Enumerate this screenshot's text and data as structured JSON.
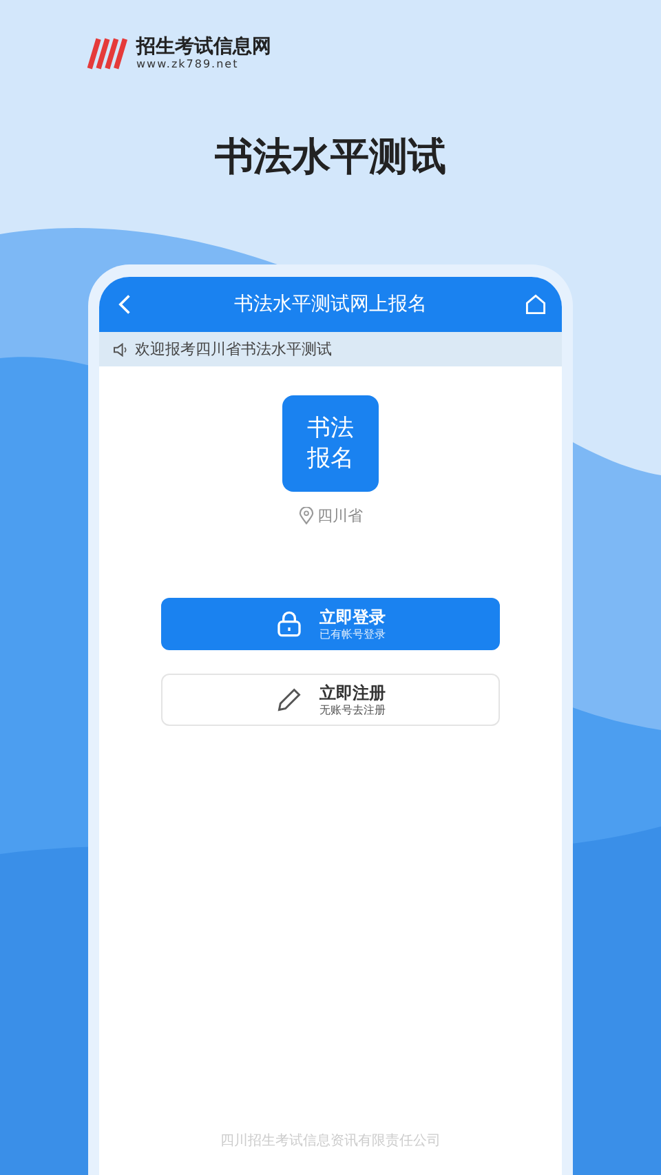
{
  "logo": {
    "name": "招生考试信息网",
    "url": "www.zk789.net"
  },
  "headline": "书法水平测试",
  "phone": {
    "title": "书法水平测试网上报名",
    "notice": "欢迎报考四川省书法水平测试",
    "app_icon": [
      "书法",
      "报名"
    ],
    "location": "四川省",
    "buttons": [
      {
        "kind": "filled",
        "title": "立即登录",
        "subtitle": "已有帐号登录"
      },
      {
        "kind": "outline",
        "title": "立即注册",
        "subtitle": "无账号去注册"
      }
    ],
    "footer": "四川招生考试信息资讯有限责任公司"
  }
}
